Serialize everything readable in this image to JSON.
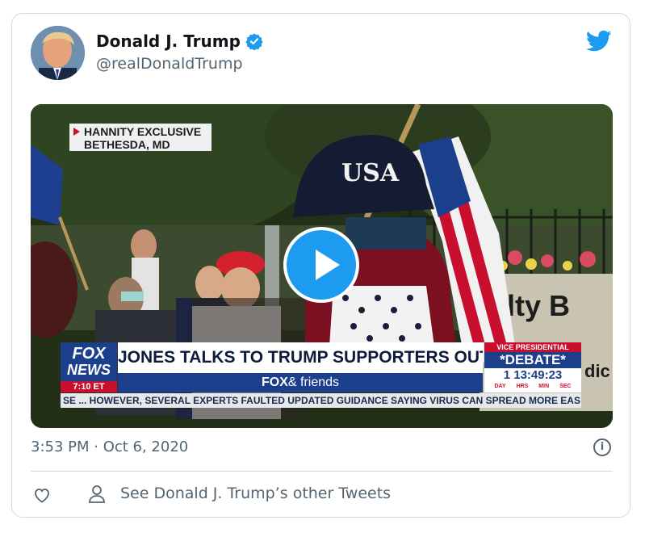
{
  "tweet": {
    "author_name": "Donald J. Trump",
    "handle": "@realDonaldTrump",
    "timestamp": "3:53 PM · Oct 6, 2020",
    "other_tweets_label": "See Donald J. Trump’s other Tweets",
    "info_glyph": "i"
  },
  "video": {
    "location_line1": "HANNITY EXCLUSIVE",
    "location_line2": "BETHESDA, MD",
    "network_line1": "FOX",
    "network_line2": "NEWS",
    "clock": "7:10 ET",
    "headline": "JONES TALKS TO TRUMP SUPPORTERS OUTSIDE HOSPITAL",
    "show_strong": "FOX",
    "show_rest": "& friends",
    "debate_header": "VICE PRESIDENTIAL",
    "debate_title": "*DEBATE*",
    "countdown": "1 13:49:23",
    "countdown_units": [
      "DAY",
      "HRS",
      "MIN",
      "SEC"
    ],
    "ticker": "SE ... HOWEVER, SEVERAL EXPERTS FAULTED UPDATED GUIDANCE SAYING VIRUS CAN SPREAD MORE EAS",
    "cap_text": "USA",
    "sign_text": "ılty B",
    "sign_text2": "dic"
  },
  "icons": {
    "verified": "verified-badge-icon",
    "platform": "twitter-bird-icon",
    "play": "play-icon",
    "like": "heart-icon",
    "profile": "person-icon",
    "info": "info-icon"
  },
  "colors": {
    "accent": "#1d9bf0",
    "text_primary": "#0f1419",
    "text_secondary": "#536471",
    "fox_blue": "#1c3f8c",
    "fox_red": "#c8102e"
  }
}
